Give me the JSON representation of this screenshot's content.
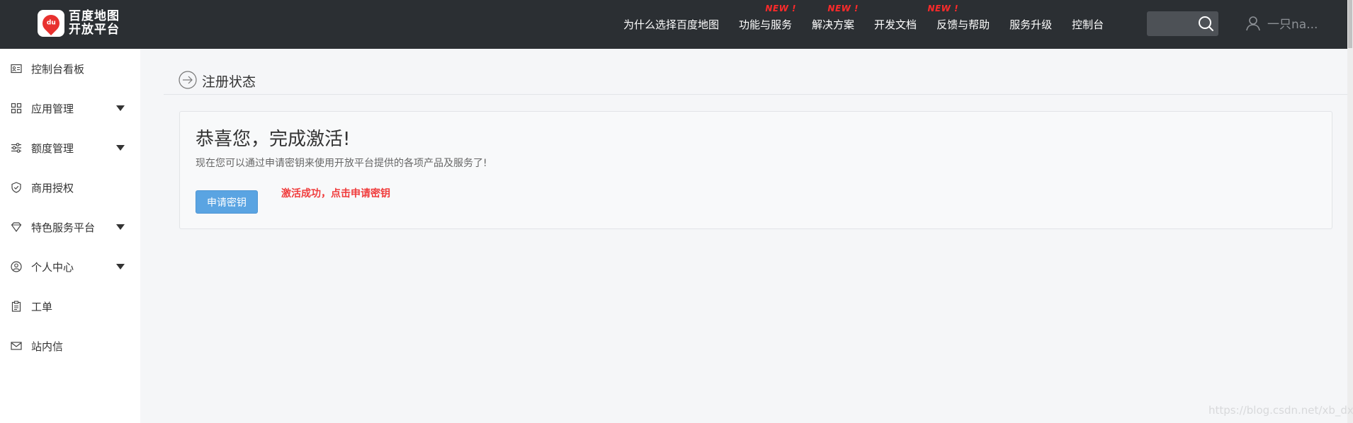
{
  "topbar": {
    "logo_line1": "百度地图",
    "logo_line2": "开放平台",
    "logo_mark": "du",
    "nav": [
      {
        "label": "为什么选择百度地图",
        "badge": ""
      },
      {
        "label": "功能与服务",
        "badge": "NEW !"
      },
      {
        "label": "解决方案",
        "badge": "NEW !"
      },
      {
        "label": "开发文档",
        "badge": ""
      },
      {
        "label": "反馈与帮助",
        "badge": "NEW !"
      },
      {
        "label": "服务升级",
        "badge": ""
      },
      {
        "label": "控制台",
        "badge": ""
      }
    ],
    "search": {
      "value": "",
      "placeholder": ""
    },
    "user_name": "一只na..."
  },
  "sidebar": {
    "items": [
      {
        "label": "控制台看板",
        "icon": "dashboard-card-icon",
        "expandable": false
      },
      {
        "label": "应用管理",
        "icon": "grid-icon",
        "expandable": true
      },
      {
        "label": "额度管理",
        "icon": "sliders-icon",
        "expandable": true
      },
      {
        "label": "商用授权",
        "icon": "shield-check-icon",
        "expandable": false
      },
      {
        "label": "特色服务平台",
        "icon": "diamond-icon",
        "expandable": true
      },
      {
        "label": "个人中心",
        "icon": "user-circle-icon",
        "expandable": true
      },
      {
        "label": "工单",
        "icon": "clipboard-icon",
        "expandable": false
      },
      {
        "label": "站内信",
        "icon": "mail-icon",
        "expandable": false
      }
    ]
  },
  "main": {
    "page_title": "注册状态",
    "card": {
      "heading": "恭喜您，完成激活!",
      "description": "现在您可以通过申请密钥来使用开放平台提供的各项产品及服务了!",
      "button_label": "申请密钥",
      "annotation": "激活成功，点击申请密钥"
    }
  },
  "watermark": "https://blog.csdn.net/xb_dxc",
  "colors": {
    "topbar_bg": "#2b2f33",
    "page_bg": "#f5f6f8",
    "primary_button": "#5aa4e2",
    "badge_red": "#ff2a2a",
    "annotation_red": "#f03c3c"
  }
}
